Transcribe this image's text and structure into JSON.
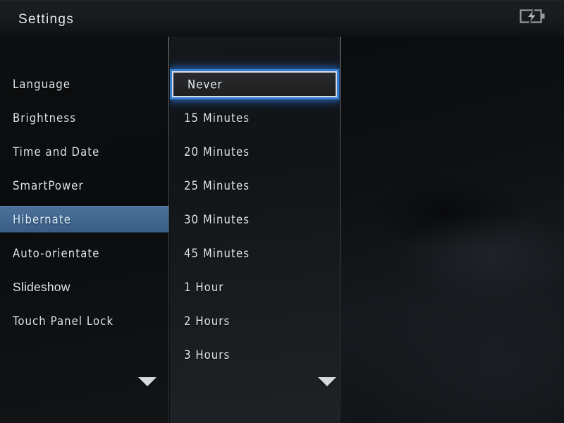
{
  "header": {
    "title": "Settings",
    "battery_icon": "battery-charging-icon"
  },
  "sidebar": {
    "name": "settings-menu",
    "selected_index": 4,
    "items": [
      {
        "label": "Language"
      },
      {
        "label": "Brightness"
      },
      {
        "label": "Time and Date"
      },
      {
        "label": "SmartPower"
      },
      {
        "label": "Hibernate"
      },
      {
        "label": "Auto-orientate"
      },
      {
        "label": "Slideshow"
      },
      {
        "label": "Touch Panel Lock"
      }
    ],
    "scroll_down_icon": "chevron-down-icon"
  },
  "options": {
    "name": "hibernate-options",
    "selected_index": 0,
    "selected_value": "Never",
    "items": [
      {
        "label": "Never"
      },
      {
        "label": "15 Minutes"
      },
      {
        "label": "20 Minutes"
      },
      {
        "label": "25 Minutes"
      },
      {
        "label": "30 Minutes"
      },
      {
        "label": "45 Minutes"
      },
      {
        "label": "1 Hour"
      },
      {
        "label": "2 Hours"
      },
      {
        "label": "3 Hours"
      }
    ],
    "scroll_down_icon": "chevron-down-icon"
  },
  "preview": {
    "name": "preview-pane",
    "content": ""
  },
  "colors": {
    "selection_band": "#456992",
    "focus_glow": "#3880d6",
    "focus_border": "#d7dde3",
    "text": "#e3e7ea",
    "background": "#0b0d0f",
    "divider": "#9aa6b2"
  }
}
